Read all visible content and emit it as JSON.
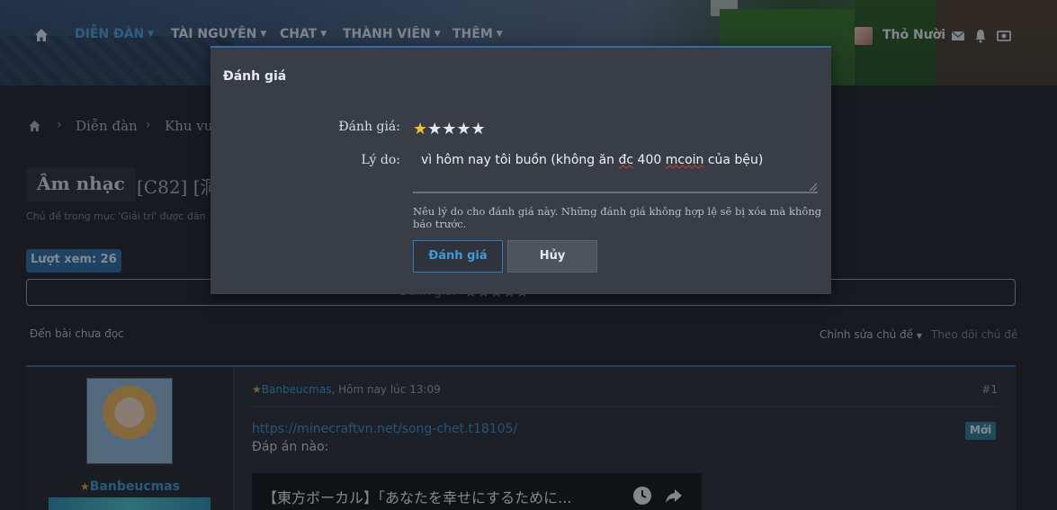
{
  "nav": {
    "items": [
      "DIỄN ĐÀN",
      "TÀI NGUYÊN",
      "CHAT",
      "THÀNH VIÊN",
      "THÊM"
    ],
    "user_name": "Thỏ Nười",
    "icons": [
      "home-icon",
      "chevron-down-icon",
      "envelope-icon",
      "bell-icon",
      "camera-icon"
    ]
  },
  "breadcrumb": [
    "Diễn đàn",
    "Khu vu"
  ],
  "thread": {
    "prefix": "Âm nhạc",
    "title_visible": "[C82] [洞",
    "description": "Chủ đề trong mục 'Giải trí' được đăn",
    "views": "Lượt xem: 26",
    "rating_label": "Đánh giá:",
    "rating_stars": "★★★★★",
    "unread_link": "Đến bài chưa đọc",
    "edit_link": "Chỉnh sửa chủ đề",
    "follow_link": "Theo dõi chủ đề"
  },
  "post": {
    "username": "Banbeucmas",
    "meta_user": "Banbeucmas",
    "meta_time": ", Hôm nay lúc 13:09",
    "number": "#1",
    "link": "https://minecraftvn.net/song-chet.t18105/",
    "text": "Đáp án nào:",
    "badge": "Mới",
    "video_title": "【東方ボーカル】「あなたを幸せにするために..."
  },
  "dialog": {
    "title": "Đánh giá",
    "rating_label": "Đánh giá:",
    "rating_value": 1,
    "rating_max": 5,
    "star_on": "★",
    "star_off": "★★★★",
    "reason_label": "Lý do:",
    "reason_pre": "vì hôm nay tôi buồn (không ăn ",
    "reason_spell1": "đc",
    "reason_mid": " 400 ",
    "reason_spell2": "mcoin",
    "reason_post": " của bệu)",
    "hint": "Nêu lý do cho đánh giá này. Những đánh giá không hợp lệ sẽ bị xóa mà không báo trước.",
    "submit_label": "Đánh giá",
    "cancel_label": "Hủy"
  },
  "colors": {
    "accent": "#2a6fa7",
    "link": "#3d9ad8",
    "star_active": "#f2c12e",
    "dialog_bg": "#393d46",
    "page_bg": "#23262d"
  }
}
